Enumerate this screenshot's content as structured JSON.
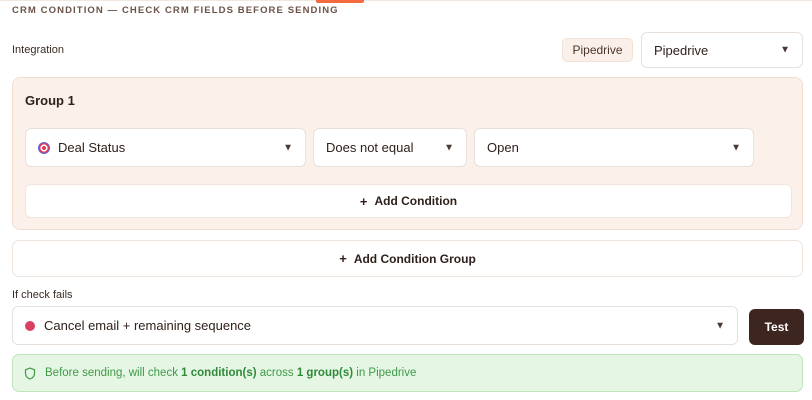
{
  "section": {
    "title": "CRM CONDITION — CHECK CRM FIELDS BEFORE SENDING"
  },
  "integration": {
    "label": "Integration",
    "badge": "Pipedrive",
    "selected": "Pipedrive"
  },
  "group": {
    "title": "Group 1",
    "condition": {
      "field": "Deal Status",
      "field_icon": "target-icon",
      "operator": "Does not equal",
      "value": "Open"
    },
    "add_condition_label": "Add Condition"
  },
  "add_group_label": "Add Condition Group",
  "on_fail": {
    "label": "If check fails",
    "selected": "Cancel email + remaining sequence",
    "status_color": "#d94062",
    "test_label": "Test"
  },
  "summary": {
    "prefix": "Before sending, will check",
    "conditions": "1 condition(s)",
    "middle": "across",
    "groups": "1 group(s)",
    "suffix": "in Pipedrive"
  },
  "colors": {
    "accent": "#f26a3d",
    "group_bg": "#fbf1ea",
    "button_dark": "#3d2620",
    "success_bg": "#e6f6e4",
    "success_text": "#3e9a47"
  }
}
